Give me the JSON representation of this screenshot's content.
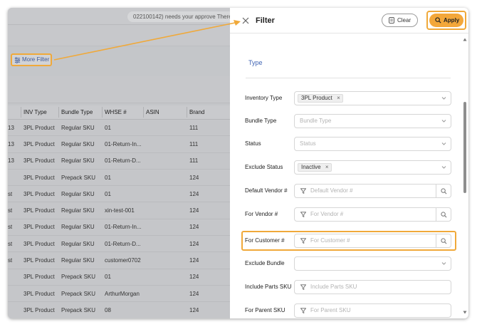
{
  "background": {
    "notice": "022100142) needs your approve  There",
    "more_filter": "More Filter",
    "table": {
      "columns": [
        "INV Type",
        "Bundle Type",
        "WHSE #",
        "ASIN",
        "Brand"
      ],
      "rows": [
        {
          "lead": "13",
          "inv": "3PL Product",
          "bundle": "Regular SKU",
          "whse": "01",
          "asin": "",
          "brand": "111"
        },
        {
          "lead": "13",
          "inv": "3PL Product",
          "bundle": "Regular SKU",
          "whse": "01-Return-In...",
          "asin": "",
          "brand": "111"
        },
        {
          "lead": "13",
          "inv": "3PL Product",
          "bundle": "Regular SKU",
          "whse": "01-Return-D...",
          "asin": "",
          "brand": "111"
        },
        {
          "lead": "",
          "inv": "3PL Product",
          "bundle": "Prepack SKU",
          "whse": "01",
          "asin": "",
          "brand": "124"
        },
        {
          "lead": "st",
          "inv": "3PL Product",
          "bundle": "Regular SKU",
          "whse": "01",
          "asin": "",
          "brand": "124"
        },
        {
          "lead": "st",
          "inv": "3PL Product",
          "bundle": "Regular SKU",
          "whse": "xin-test-001",
          "asin": "",
          "brand": "124"
        },
        {
          "lead": "st",
          "inv": "3PL Product",
          "bundle": "Regular SKU",
          "whse": "01-Return-In...",
          "asin": "",
          "brand": "124"
        },
        {
          "lead": "st",
          "inv": "3PL Product",
          "bundle": "Regular SKU",
          "whse": "01-Return-D...",
          "asin": "",
          "brand": "124"
        },
        {
          "lead": "st",
          "inv": "3PL Product",
          "bundle": "Regular SKU",
          "whse": "customer0702",
          "asin": "",
          "brand": "124"
        },
        {
          "lead": "",
          "inv": "3PL Product",
          "bundle": "Prepack SKU",
          "whse": "01",
          "asin": "",
          "brand": "124"
        },
        {
          "lead": "",
          "inv": "3PL Product",
          "bundle": "Prepack SKU",
          "whse": "ArthurMorgan",
          "asin": "",
          "brand": "124"
        },
        {
          "lead": "",
          "inv": "3PL Product",
          "bundle": "Prepack SKU",
          "whse": "08",
          "asin": "",
          "brand": "124"
        }
      ]
    }
  },
  "drawer": {
    "title": "Filter",
    "clear_label": "Clear",
    "apply_label": "Apply",
    "section": "Type",
    "fields": {
      "inventory_type": {
        "label": "Inventory Type",
        "tag": "3PL Product"
      },
      "bundle_type": {
        "label": "Bundle Type",
        "placeholder": "Bundle Type"
      },
      "status": {
        "label": "Status",
        "placeholder": "Status"
      },
      "exclude_status": {
        "label": "Exclude Status",
        "tag": "Inactive"
      },
      "default_vendor": {
        "label": "Default Vendor #",
        "placeholder": "Default Vendor #"
      },
      "for_vendor": {
        "label": "For Vendor #",
        "placeholder": "For Vendor #"
      },
      "for_customer": {
        "label": "For Customer #",
        "placeholder": "For Customer #"
      },
      "exclude_bundle": {
        "label": "Exclude Bundle"
      },
      "include_parts": {
        "label": "Include Parts SKU",
        "placeholder": "Include Parts SKU"
      },
      "for_parent": {
        "label": "For Parent SKU",
        "placeholder": "For Parent SKU"
      }
    }
  },
  "colors": {
    "accent": "#f0a93a",
    "apply_bg": "#f3a73a",
    "link_blue": "#3d62b3"
  },
  "icons": [
    "more-filter-icon",
    "close-icon",
    "clear-icon",
    "search-icon",
    "funnel-icon",
    "chevron-down-icon",
    "tag-remove-icon"
  ]
}
